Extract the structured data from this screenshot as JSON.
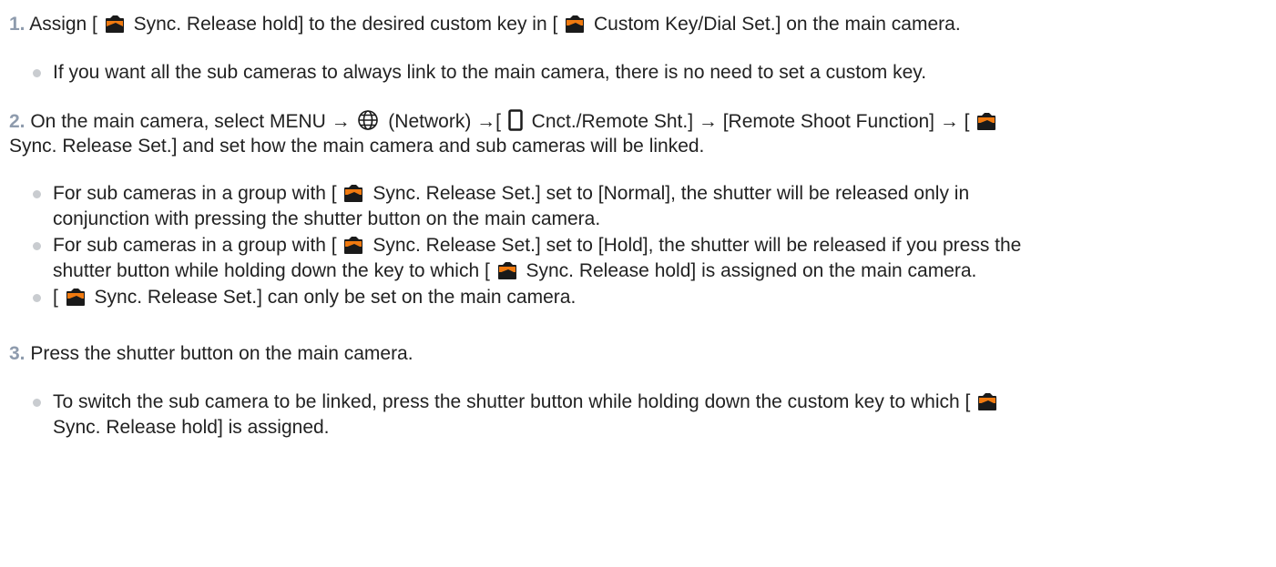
{
  "steps": [
    {
      "number": "1.",
      "lines": [
        {
          "before": " Assign [ ",
          "icon1": "camera-icon",
          "mid": " Sync. Release hold] to the desired custom key in [ ",
          "icon2": "camera-icon",
          "after": " Custom Key/Dial Set.] on the main camera."
        }
      ],
      "bullets": [
        {
          "text": "If you want all the sub cameras to always link to the main camera, there is no need to set a custom key."
        }
      ]
    },
    {
      "number": "2.",
      "lines": [
        {
          "a": " On the main camera, select MENU → ",
          "network_icon": "globe-icon",
          "b": " (Network) →[ ",
          "remote_icon": "remote-icon",
          "c": " Cnct./Remote Sht.] → [Remote Shoot Function] → [ ",
          "camera_icon": "camera-icon"
        },
        {
          "text": "Sync. Release Set.] and set how the main camera and sub cameras will be linked."
        }
      ],
      "bullets": [
        {
          "line1_before": "For sub cameras in a group with [ ",
          "icon": "camera-icon",
          "line1_after": " Sync. Release Set.] set to [Normal], the shutter will be released only in",
          "line2": "conjunction with pressing the shutter button on the main camera."
        },
        {
          "line1_before": "For sub cameras in a group with [ ",
          "icon": "camera-icon",
          "line1_after": " Sync. Release Set.] set to [Hold], the shutter will be released if you press the",
          "line2_before": "shutter button while holding down the key to which [ ",
          "line2_after": " Sync. Release hold] is assigned on the main camera."
        },
        {
          "before": "[ ",
          "icon": "camera-icon",
          "after": " Sync. Release Set.] can only be set on the main camera."
        }
      ]
    },
    {
      "number": "3.",
      "lines": [
        {
          "text": " Press the shutter button on the main camera."
        }
      ],
      "bullets": [
        {
          "line1_before": "To switch the sub camera to be linked, press the shutter button while holding down the custom key to which [ ",
          "icon": "camera-icon",
          "line2": "Sync. Release hold] is assigned."
        }
      ]
    }
  ]
}
